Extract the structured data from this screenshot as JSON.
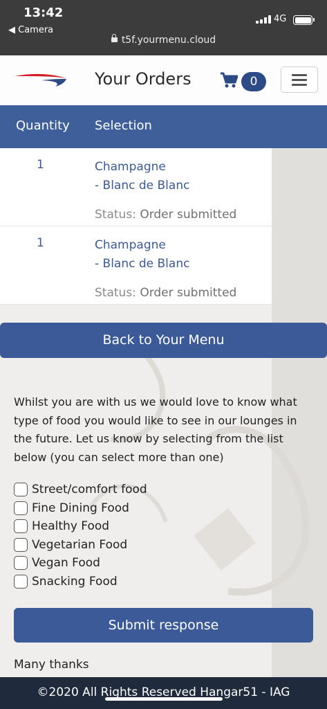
{
  "status_bar": {
    "time": "13:42",
    "back_app": "◀ Camera",
    "network": "4G"
  },
  "browser": {
    "url": "t5f.yourmenu.cloud"
  },
  "header": {
    "title": "Your Orders",
    "cart_count": "0"
  },
  "orders_table": {
    "columns": [
      "Quantity",
      "Selection"
    ],
    "status_label": "Status:",
    "rows": [
      {
        "quantity": "1",
        "item_line1": "Champagne",
        "item_line2": "- Blanc de Blanc",
        "status": "Order submitted"
      },
      {
        "quantity": "1",
        "item_line1": "Champagne",
        "item_line2": "- Blanc de Blanc",
        "status": "Order submitted"
      }
    ]
  },
  "back_button": "Back to Your Menu",
  "survey": {
    "intro": "Whilst you are with us we would love to know what type of food you would like to see in our lounges in the future. Let us know by selecting from the list below (you can select more than one)",
    "options": [
      "Street/comfort food",
      "Fine Dining Food",
      "Healthy Food",
      "Vegetarian Food",
      "Vegan Food",
      "Snacking Food"
    ],
    "submit": "Submit response"
  },
  "thanks": "Many thanks",
  "footer": "©2020 All Rights Reserved Hangar51 - IAG",
  "colors": {
    "brand_blue": "#3c5a97",
    "link_blue": "#3a5a95",
    "footer": "#1f2a3c",
    "logo_red": "#d21f2b"
  }
}
